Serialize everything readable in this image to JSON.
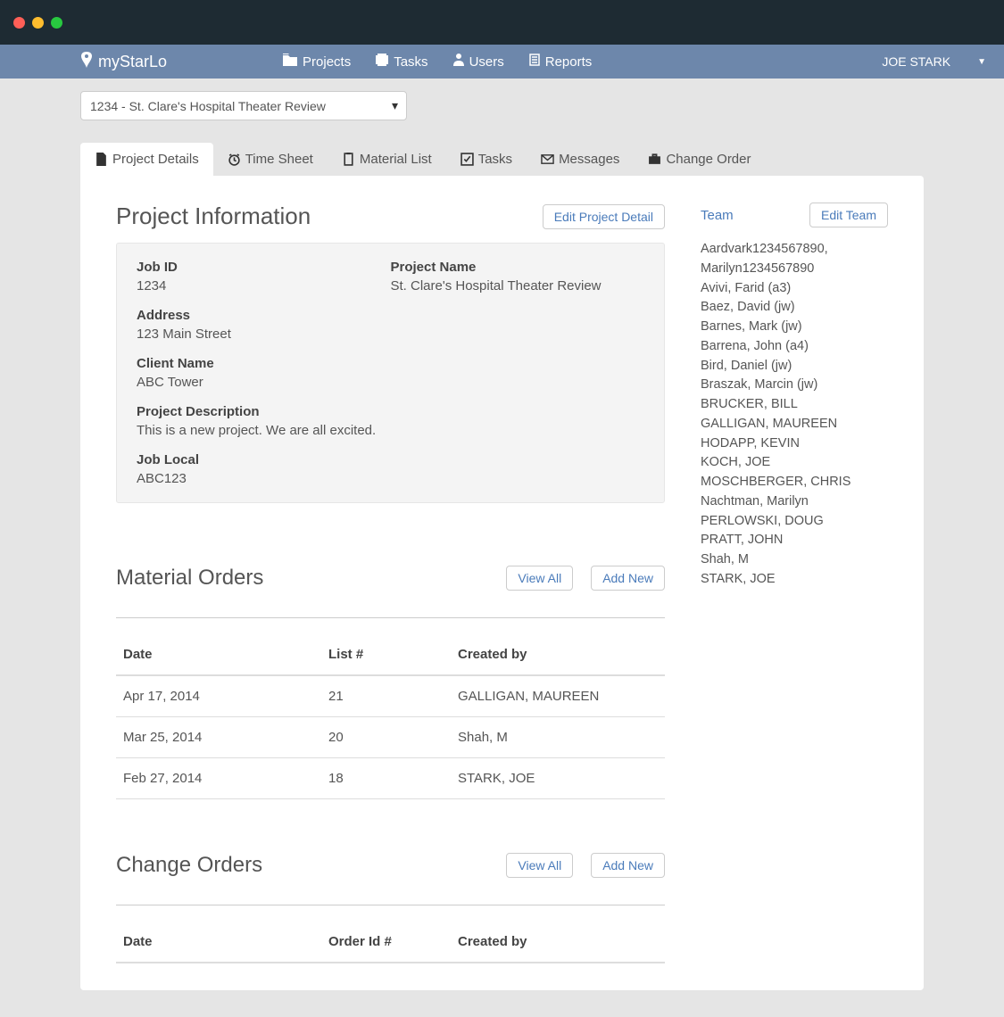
{
  "brand": "myStarLo",
  "nav": {
    "projects": "Projects",
    "tasks": "Tasks",
    "users": "Users",
    "reports": "Reports"
  },
  "user": "JOE STARK",
  "projectSelect": "1234 - St. Clare's Hospital Theater Review",
  "tabs": {
    "details": "Project Details",
    "timesheet": "Time Sheet",
    "materialList": "Material List",
    "tasks": "Tasks",
    "messages": "Messages",
    "changeOrder": "Change Order"
  },
  "projectInfo": {
    "title": "Project Information",
    "editBtn": "Edit Project Detail",
    "fields": {
      "jobIdLabel": "Job ID",
      "jobId": "1234",
      "projectNameLabel": "Project Name",
      "projectName": "St. Clare's Hospital Theater Review",
      "addressLabel": "Address",
      "address": "123 Main Street",
      "clientNameLabel": "Client Name",
      "clientName": "ABC Tower",
      "descriptionLabel": "Project Description",
      "description": "This is a new project. We are all excited.",
      "jobLocalLabel": "Job Local",
      "jobLocal": "ABC123"
    }
  },
  "team": {
    "title": "Team",
    "editBtn": "Edit Team",
    "members": [
      "Aardvark1234567890, Marilyn1234567890",
      "Avivi, Farid (a3)",
      "Baez, David (jw)",
      "Barnes, Mark (jw)",
      "Barrena, John (a4)",
      "Bird, Daniel (jw)",
      "Braszak, Marcin (jw)",
      "BRUCKER, BILL",
      "GALLIGAN, MAUREEN",
      "HODAPP, KEVIN",
      "KOCH, JOE",
      "MOSCHBERGER, CHRIS",
      "Nachtman, Marilyn",
      "PERLOWSKI, DOUG",
      "PRATT, JOHN",
      "Shah, M",
      "STARK, JOE"
    ]
  },
  "materialOrders": {
    "title": "Material Orders",
    "viewAll": "View All",
    "addNew": "Add New",
    "headers": {
      "date": "Date",
      "list": "List #",
      "createdBy": "Created by"
    },
    "rows": [
      {
        "date": "Apr 17, 2014",
        "list": "21",
        "createdBy": "GALLIGAN, MAUREEN"
      },
      {
        "date": "Mar 25, 2014",
        "list": "20",
        "createdBy": "Shah, M"
      },
      {
        "date": "Feb 27, 2014",
        "list": "18",
        "createdBy": "STARK, JOE"
      }
    ]
  },
  "changeOrders": {
    "title": "Change Orders",
    "viewAll": "View All",
    "addNew": "Add New",
    "headers": {
      "date": "Date",
      "orderId": "Order Id #",
      "createdBy": "Created by"
    }
  }
}
